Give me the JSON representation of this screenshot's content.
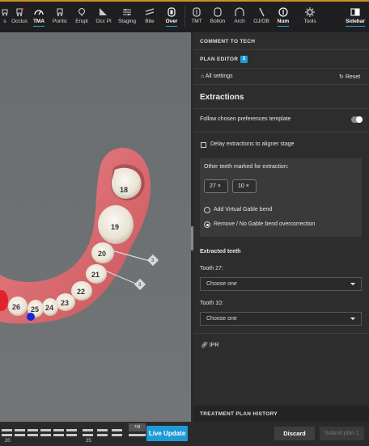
{
  "toolbar": {
    "left_tools": [
      {
        "label": "s",
        "icon": "tooth-icon"
      },
      {
        "label": "Occlus",
        "icon": "tooth-icon"
      },
      {
        "label": "TMA",
        "icon": "gauge-icon",
        "active": true
      },
      {
        "label": "Pontic",
        "icon": "tooth-outline-icon"
      },
      {
        "label": "Erupt",
        "icon": "lightbulb-icon"
      },
      {
        "label": "Occ Pl",
        "icon": "plane-icon"
      },
      {
        "label": "Staging",
        "icon": "staging-icon"
      },
      {
        "label": "Bite",
        "icon": "bite-icon"
      },
      {
        "label": "Over",
        "icon": "overlay-icon",
        "active": true
      }
    ],
    "right_tools": [
      {
        "label": "TMT",
        "icon": "tmt-icon"
      },
      {
        "label": "Bolton",
        "icon": "bolton-icon"
      },
      {
        "label": "Arch",
        "icon": "arch-icon"
      },
      {
        "label": "OJ/OB",
        "icon": "ojob-icon"
      },
      {
        "label": "Num",
        "icon": "number-icon",
        "active": true
      },
      {
        "label": "Tools",
        "icon": "gear-icon"
      },
      {
        "label": "Sidebar",
        "icon": "sidebar-icon",
        "active": true
      }
    ]
  },
  "viewport": {
    "teeth": [
      "18",
      "19",
      "20",
      "21",
      "22",
      "23",
      "24",
      "25",
      "26"
    ],
    "markers": [
      "3",
      "3"
    ]
  },
  "timeline": {
    "numbers": [
      "20",
      "25"
    ],
    "last_stage": "7/8",
    "live_update": "Live Update"
  },
  "panel": {
    "comment_header": "COMMENT TO TECH",
    "plan_editor_header": "PLAN EDITOR",
    "plan_editor_count": "2",
    "all_settings": "All settings",
    "reset": "Reset",
    "section_title": "Extractions",
    "follow_template": "Follow chosen preferences template",
    "delay_extractions": "Delay extractions to aligner stage",
    "other_teeth_label": "Other teeth marked for extraction:",
    "chips": [
      "27",
      "10"
    ],
    "radio_add_gable": "Add Virtual Gable bend",
    "radio_remove_gable": "Remove / No Gable bend overcorrection",
    "extracted_teeth": "Extracted teeth",
    "tooth27_label": "Tooth 27:",
    "tooth27_value": "Choose one",
    "tooth10_label": "Tooth 10:",
    "tooth10_value": "Choose one",
    "ipr": "IPR",
    "history_header": "TREATMENT PLAN HISTORY",
    "discard": "Discard",
    "submit": "Submit plan 1"
  },
  "colors": {
    "accent": "#1f9ad6",
    "toolbar_border": "#c98f2a",
    "gum": "#d86c70",
    "tooth": "#efe9de"
  }
}
